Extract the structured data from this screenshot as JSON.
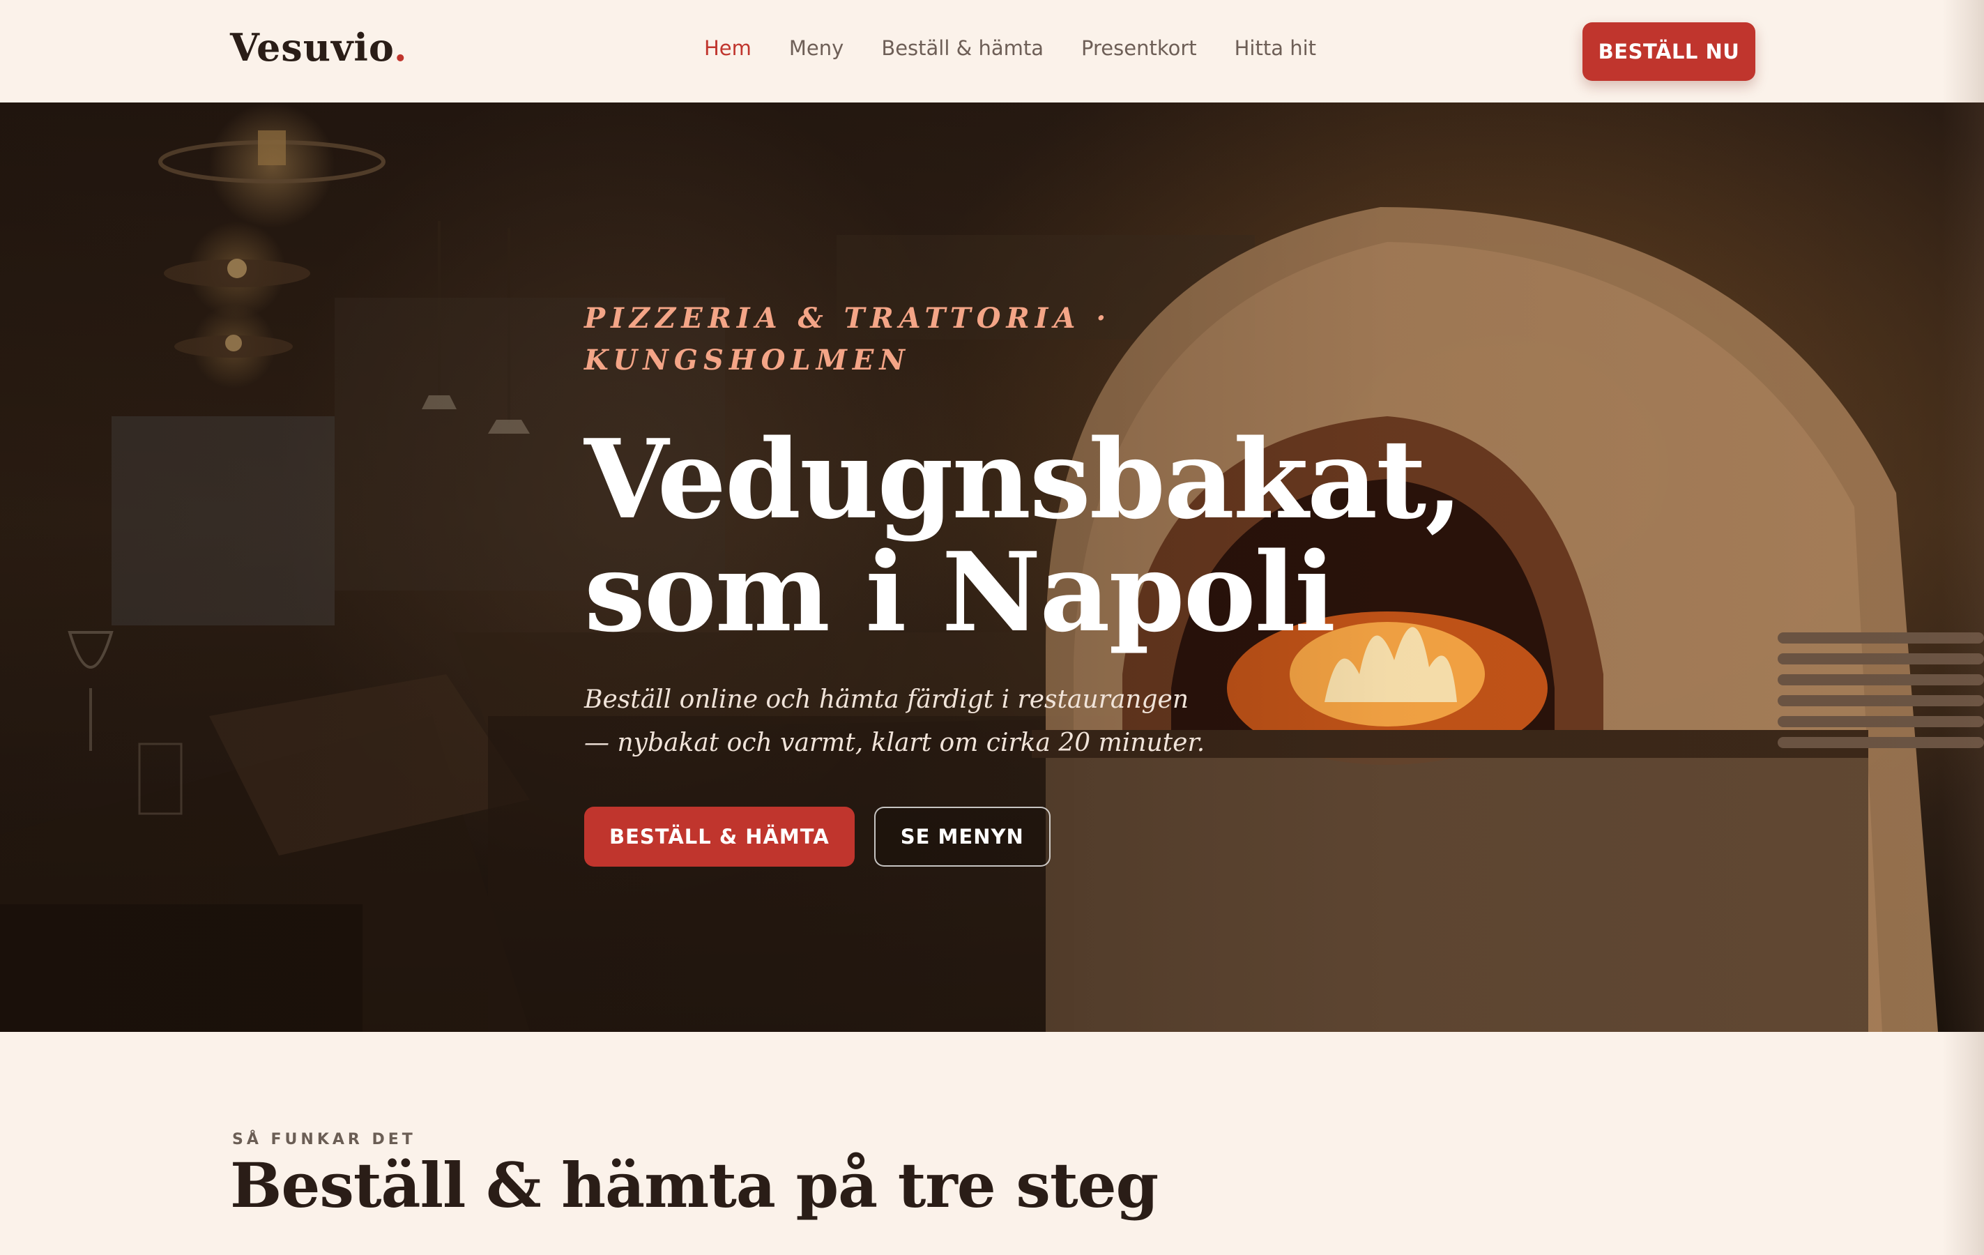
{
  "brand": {
    "name": "Vesuvio",
    "dot": ".",
    "accent": "#c0352d"
  },
  "nav": {
    "links": [
      {
        "label": "Hem",
        "active": true
      },
      {
        "label": "Meny",
        "active": false
      },
      {
        "label": "Beställ & hämta",
        "active": false
      },
      {
        "label": "Presentkort",
        "active": false
      },
      {
        "label": "Hitta hit",
        "active": false
      }
    ],
    "cta": "BESTÄLL NU"
  },
  "hero": {
    "eyebrow": "PIZZERIA & TRATTORIA · KUNGSHOLMEN",
    "headline_line1": "Vedugnsbakat,",
    "headline_line2": "som i Napoli",
    "lead": "Beställ online och hämta färdigt i restaurangen — nybakat och varmt, klart om cirka 20 minuter.",
    "primary_button": "BESTÄLL & HÄMTA",
    "secondary_button": "SE MENYN"
  },
  "steps": {
    "eyebrow": "SÅ FUNKAR DET",
    "title": "Beställ & hämta på tre steg"
  }
}
